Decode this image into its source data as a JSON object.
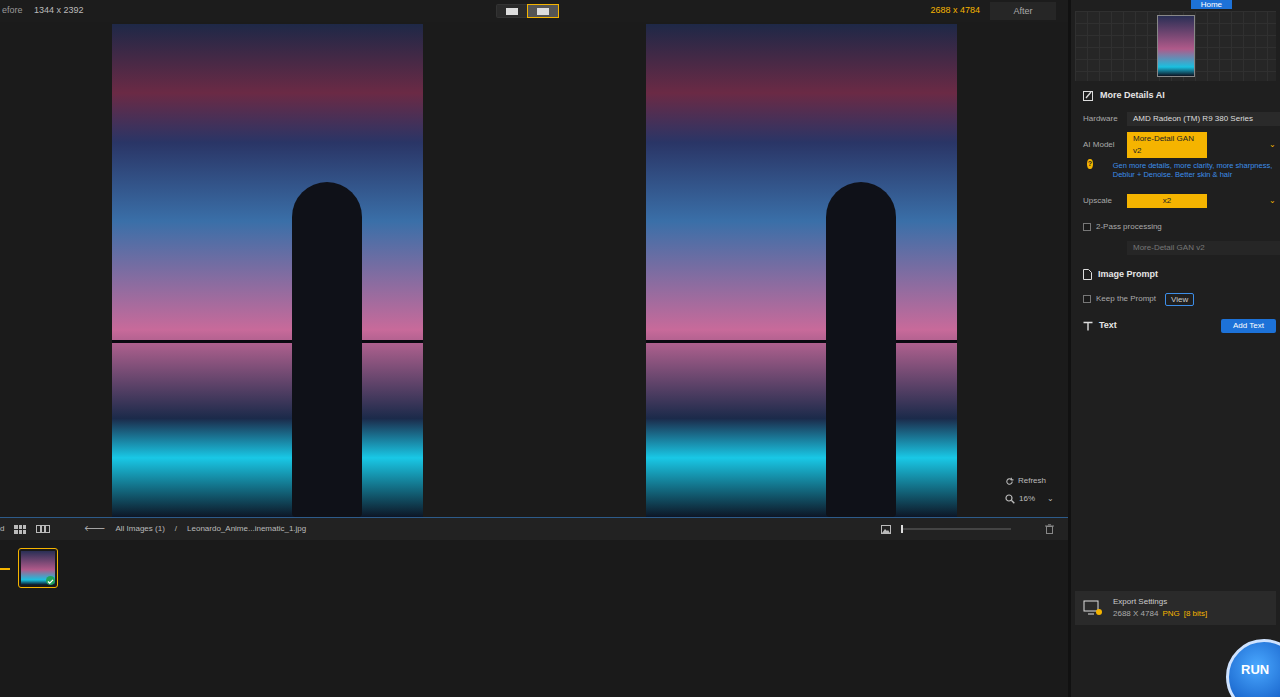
{
  "header": {
    "before_label": "efore",
    "before_size": "1344 x 2392",
    "after_size": "2688 x 4784",
    "after_label": "After",
    "compare_modes": [
      {
        "selected": false
      },
      {
        "selected": true
      }
    ]
  },
  "viewer": {
    "refresh": "Refresh",
    "zoom": "16%",
    "zoom_caret": "⌄"
  },
  "browser": {
    "view_label": "d",
    "back": "🡐",
    "breadcrumb_root": "All Images (1)",
    "separator": "/",
    "file": "Leonardo_Anime...inematic_1.jpg",
    "thumbnails": [
      {
        "selected": true,
        "processed": true
      }
    ]
  },
  "sidebar": {
    "tab": "Home",
    "section_title": "More Details AI",
    "hardware_label": "Hardware",
    "hardware": "AMD Radeon (TM) R9 380 Series",
    "model_label": "AI Model",
    "model": "More-Detail GAN v2",
    "help": "?",
    "model_description": "Gen more details, more clarity, more sharpness, Deblur + Denoise. Better skin & hair",
    "upscale_label": "Upscale",
    "upscale": "x2",
    "two_pass": {
      "label": "2-Pass processing",
      "checked": false
    },
    "two_pass_model": {
      "value": "More-Detail GAN v2",
      "disabled": true
    },
    "prompt_title": "Image Prompt",
    "keep_prompt": {
      "label": "Keep the Prompt",
      "checked": false
    },
    "view_button": "View",
    "text_title": "Text",
    "add_text": "Add Text"
  },
  "export": {
    "title": "Export Settings",
    "size": "2688 X 4784",
    "format": "PNG",
    "bits": "[8 bits]"
  },
  "run": "RUN"
}
